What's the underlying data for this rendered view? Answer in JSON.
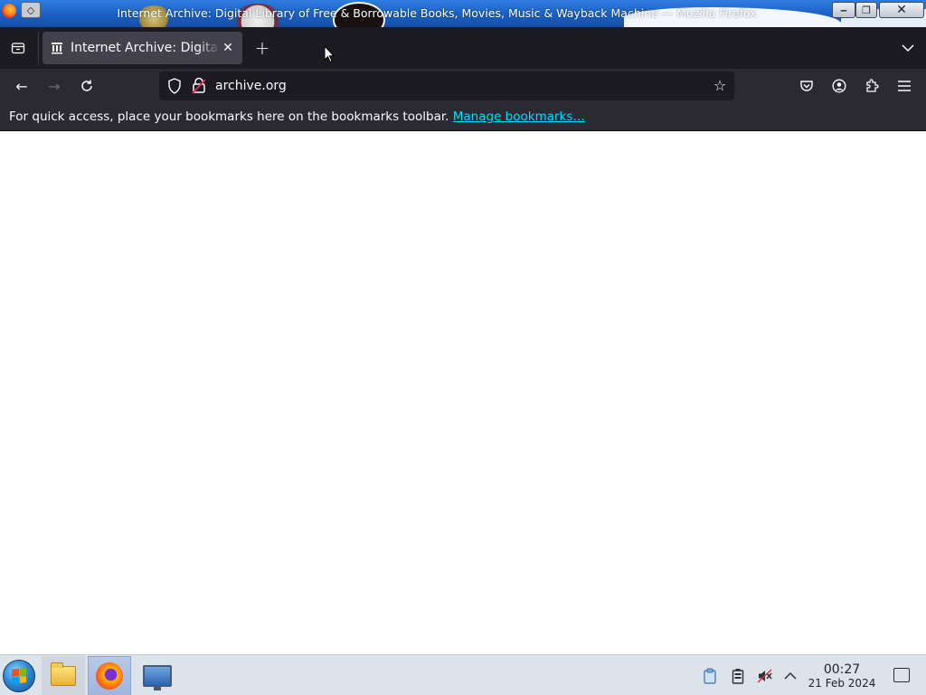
{
  "window": {
    "title": "Internet Archive: Digital Library of Free & Borrowable Books, Movies, Music & Wayback Machine — Mozilla Firefox",
    "minimize_glyph": "‒",
    "maximize_glyph": "❐",
    "close_glyph": "✕"
  },
  "tabs": [
    {
      "label": "Internet Archive: Digital Library of Free & Borrowable Books, Movies, Music & Wayback Machine",
      "icon": "museum-icon",
      "active": true
    }
  ],
  "tabstrip": {
    "new_tab_glyph": "+",
    "close_tab_glyph": "✕",
    "list_all_tabs_glyph": "⌄"
  },
  "navbar": {
    "url": "archive.org",
    "back_glyph": "←",
    "forward_glyph": "→",
    "reload_glyph": "↻",
    "forward_enabled": false
  },
  "bookmarks_toolbar": {
    "message": "For quick access, place your bookmarks here on the bookmarks toolbar.",
    "manage_link": "Manage bookmarks…"
  },
  "taskbar": {
    "apps": [
      {
        "name": "file-manager",
        "icon": "folder-icon",
        "active": false
      },
      {
        "name": "firefox",
        "icon": "firefox-icon",
        "active": true
      },
      {
        "name": "system-monitor",
        "icon": "monitor-icon",
        "active": false
      }
    ],
    "clock": {
      "time": "00:27",
      "date": "21 Feb 2024"
    },
    "tray": [
      "clipboard-icon",
      "battery-icon",
      "volume-muted-icon",
      "chevron-up-icon"
    ]
  },
  "colors": {
    "tab_strip": "#1c1b22",
    "nav_bar": "#2b2a33",
    "url_field": "#1c1b22",
    "link": "#00ddff",
    "titlebar_accent": "#1a5fc4",
    "taskbar": "#dde3ea"
  }
}
